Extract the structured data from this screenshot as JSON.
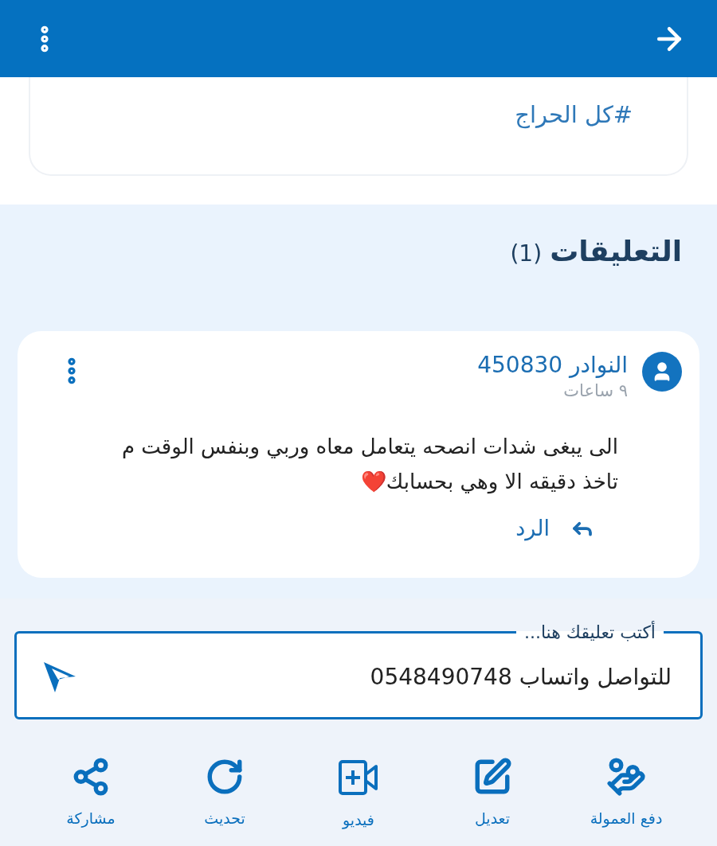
{
  "header": {
    "back": true
  },
  "tag_card": {
    "tag": "#كل الحراج"
  },
  "comments_section": {
    "title": "التعليقات",
    "count": "(1)"
  },
  "comments": [
    {
      "author": "النوادر 450830",
      "time": "٩ ساعات",
      "text": "الى يبغى شدات انصحه يتعامل معاه وربي وبنفس الوقت م تاخذ دقيقه الا وهي بحسابك❤️",
      "reply": "الرد"
    }
  ],
  "comment_input": {
    "label": "أكتب تعليقك هنا...",
    "value": "للتواصل واتساب 0548490748"
  },
  "actions": [
    {
      "kind": "commission",
      "label": "دفع العمولة"
    },
    {
      "kind": "edit",
      "label": "تعديل"
    },
    {
      "kind": "video",
      "label": "فيديو"
    },
    {
      "kind": "refresh",
      "label": "تحديث"
    },
    {
      "kind": "share",
      "label": "مشاركة"
    }
  ]
}
